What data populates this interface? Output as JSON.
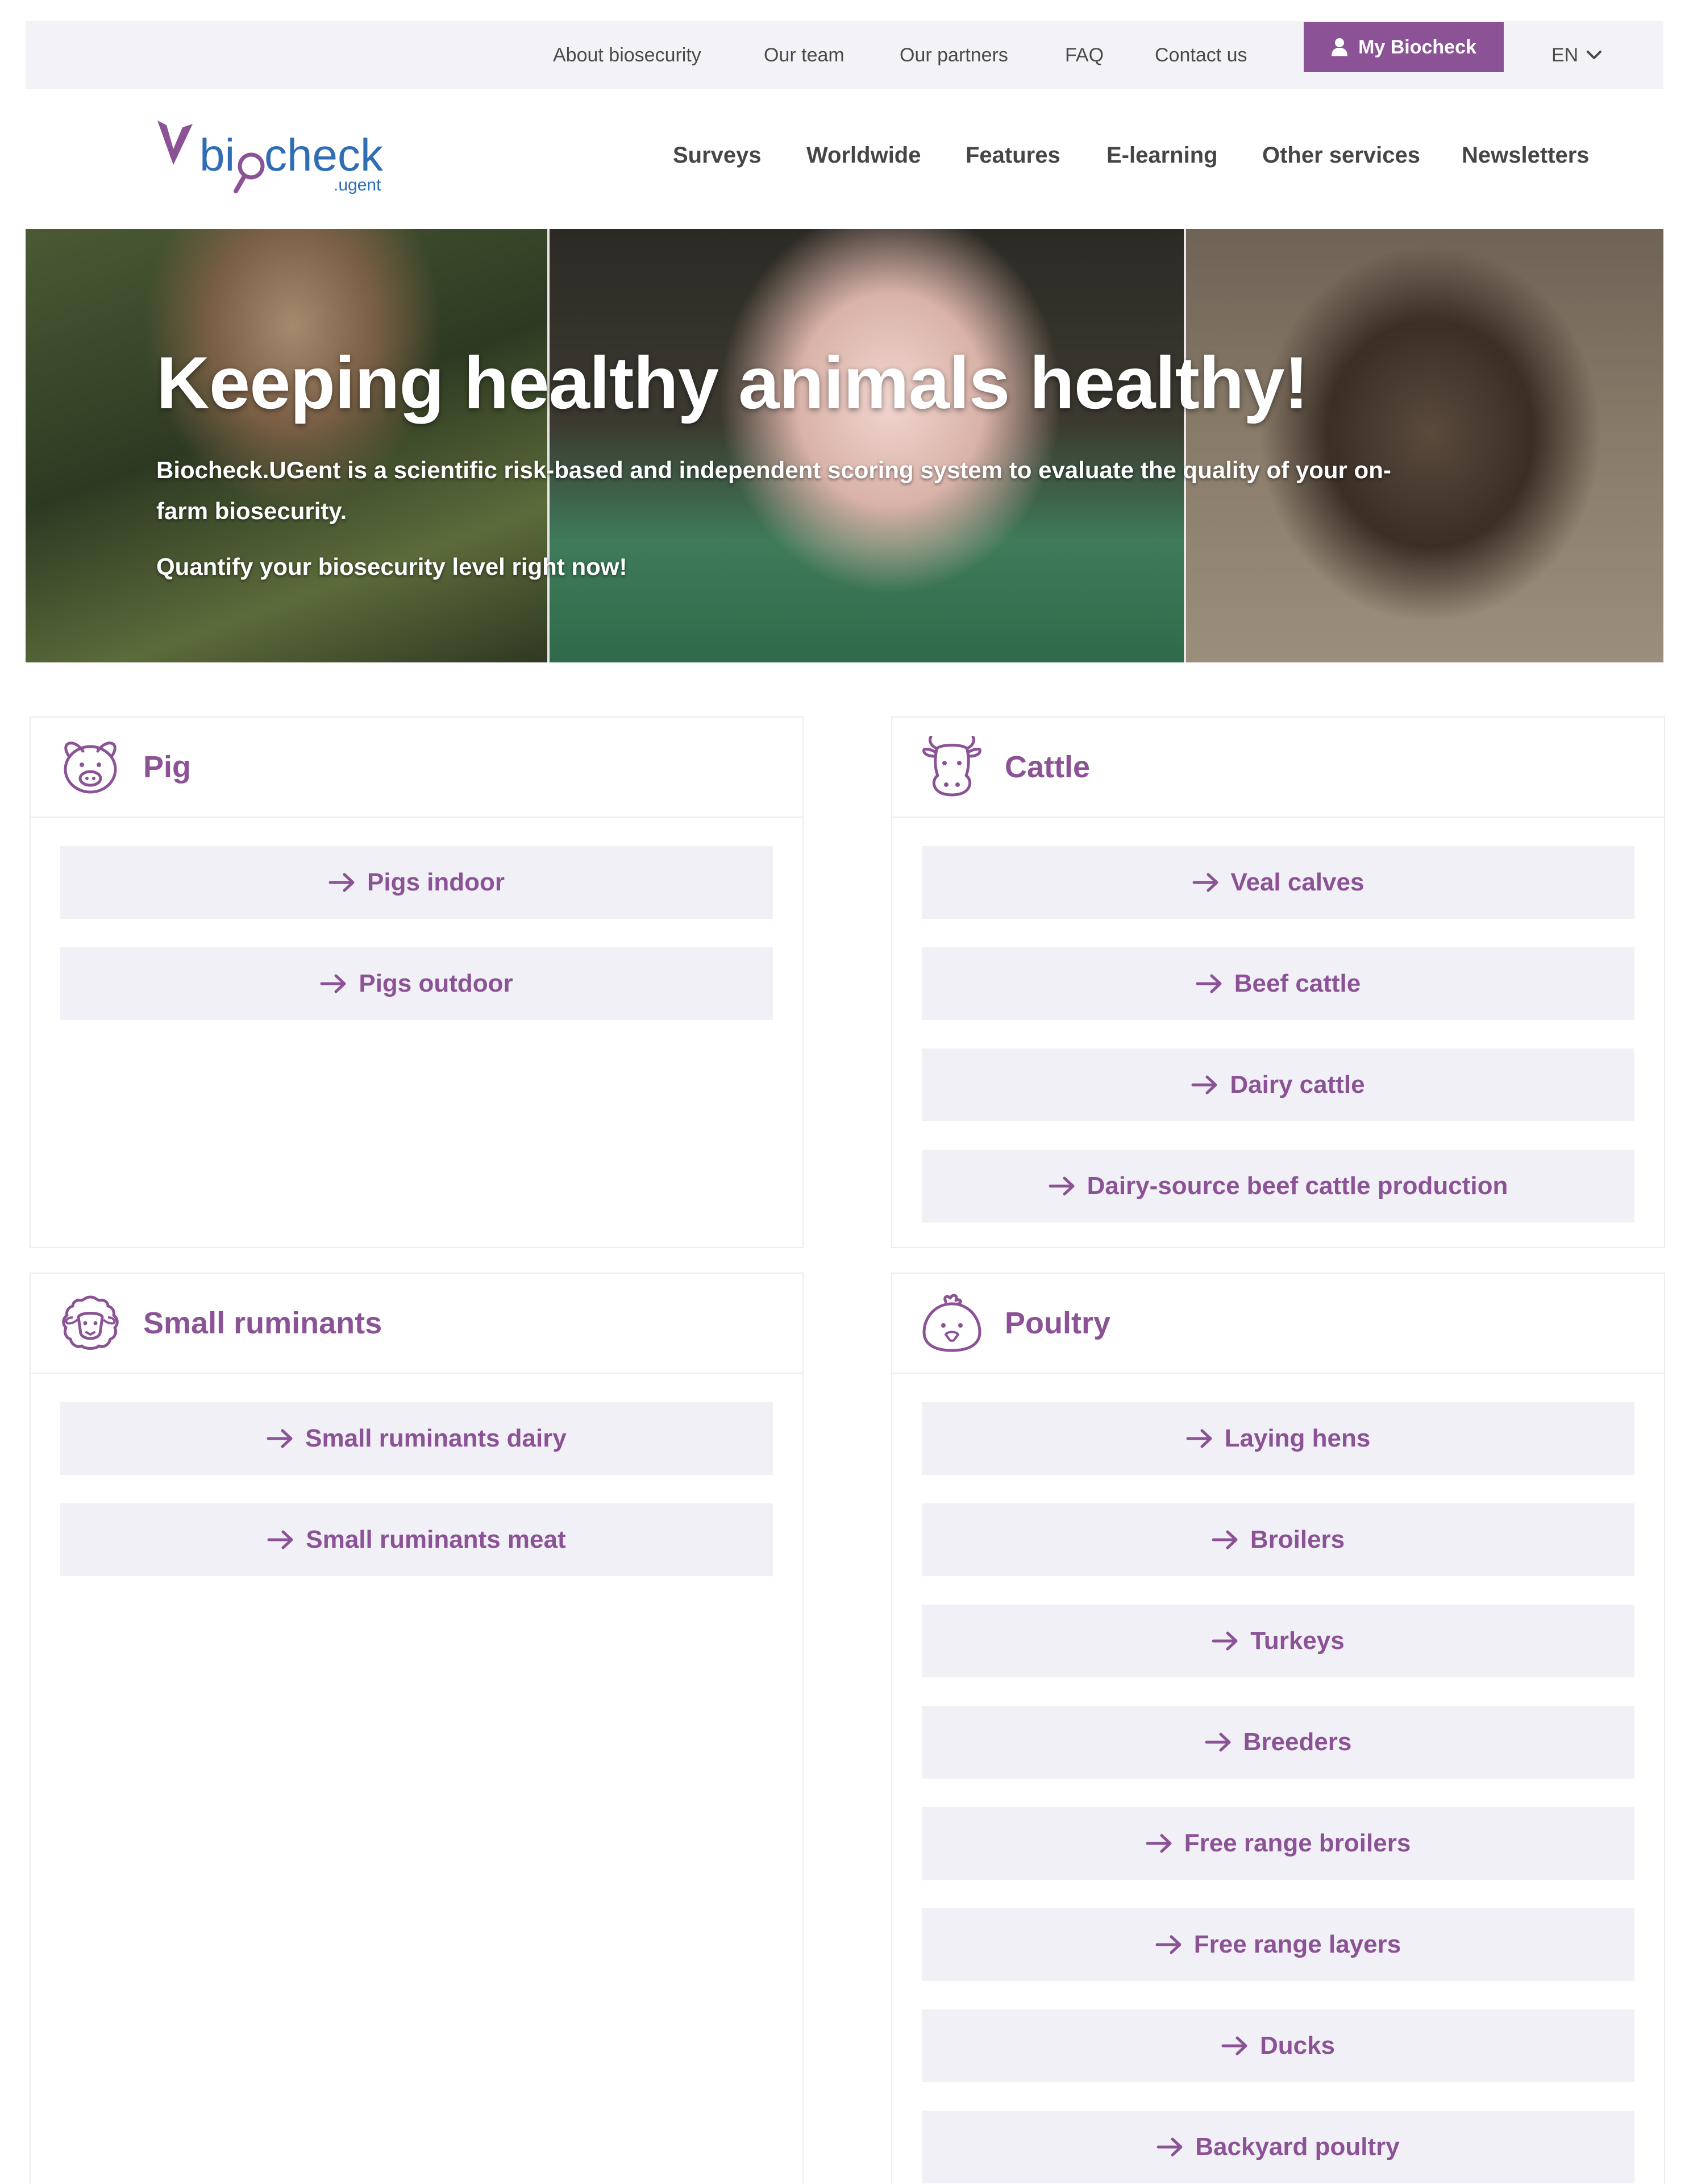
{
  "topbar": {
    "links": [
      "About biosecurity",
      "Our team",
      "Our partners",
      "FAQ",
      "Contact us"
    ],
    "my_biocheck": "My Biocheck",
    "language": "EN"
  },
  "logo": {
    "text_main": "biocheck",
    "text_sub": ".ugent"
  },
  "nav": [
    "Surveys",
    "Worldwide",
    "Features",
    "E-learning",
    "Other services",
    "Newsletters"
  ],
  "hero": {
    "title": "Keeping healthy animals healthy!",
    "subtitle": "Biocheck.UGent is a scientific risk-based and independent scoring system to evaluate the quality of your on-farm biosecurity.",
    "cta": "Quantify your biosecurity level right now!"
  },
  "cards": [
    {
      "title": "Pig",
      "icon": "pig-icon",
      "items": [
        "Pigs indoor",
        "Pigs outdoor"
      ]
    },
    {
      "title": "Cattle",
      "icon": "cow-icon",
      "items": [
        "Veal calves",
        "Beef cattle",
        "Dairy cattle",
        "Dairy-source beef cattle production"
      ]
    },
    {
      "title": "Small ruminants",
      "icon": "sheep-icon",
      "items": [
        "Small ruminants dairy",
        "Small ruminants meat"
      ]
    },
    {
      "title": "Poultry",
      "icon": "chicken-icon",
      "items": [
        "Laying hens",
        "Broilers",
        "Turkeys",
        "Breeders",
        "Free range broilers",
        "Free range layers",
        "Ducks",
        "Backyard poultry"
      ]
    }
  ],
  "colors": {
    "brand_purple": "#8b5296",
    "logo_blue": "#2f6db5",
    "item_bg": "#f1f0f6",
    "topbar_bg": "#f3f2f7"
  }
}
